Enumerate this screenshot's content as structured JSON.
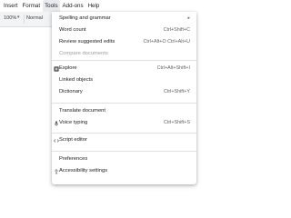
{
  "menubar": {
    "items": [
      "Insert",
      "Format",
      "Tools",
      "Add-ons",
      "Help"
    ]
  },
  "toolbar": {
    "zoom_value": "100%",
    "style_value": "Normal"
  },
  "tools_menu": {
    "items": [
      {
        "label": "Spelling and grammar",
        "shortcut": "",
        "submenu": true,
        "disabled": false
      },
      {
        "label": "Word count",
        "shortcut": "Ctrl+Shift+C",
        "disabled": false
      },
      {
        "label": "Review suggested edits",
        "shortcut": "Ctrl+Alt+O  Ctrl+Alt+U",
        "disabled": false
      },
      {
        "label": "Compare documents",
        "shortcut": "",
        "disabled": true
      },
      {
        "label": "Explore",
        "shortcut": "Ctrl+Alt+Shift+I",
        "icon": "explore-icon",
        "disabled": false
      },
      {
        "label": "Linked objects",
        "shortcut": "",
        "disabled": false
      },
      {
        "label": "Dictionary",
        "shortcut": "Ctrl+Shift+Y",
        "disabled": false
      },
      {
        "label": "Translate document",
        "shortcut": "",
        "disabled": false
      },
      {
        "label": "Voice typing",
        "shortcut": "Ctrl+Shift+S",
        "icon": "microphone-icon",
        "disabled": false
      },
      {
        "label": "Script editor",
        "shortcut": "",
        "icon": "code-icon",
        "disabled": false
      },
      {
        "label": "Preferences",
        "shortcut": "",
        "disabled": false
      },
      {
        "label": "Accessibility settings",
        "shortcut": "",
        "icon": "accessibility-icon",
        "disabled": false
      }
    ]
  }
}
